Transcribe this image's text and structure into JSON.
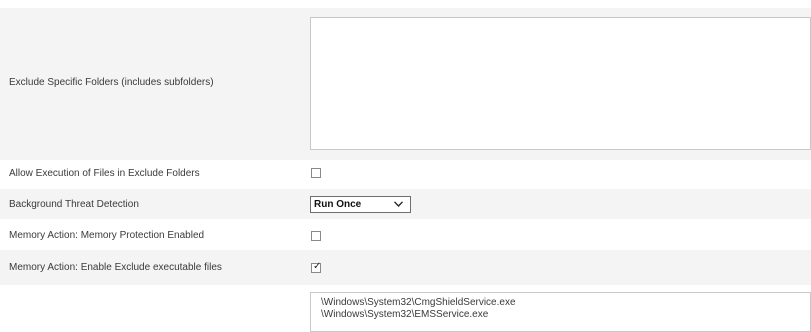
{
  "settings": {
    "exclude_folders": {
      "label": "Exclude Specific Folders (includes subfolders)",
      "value": ""
    },
    "allow_execution": {
      "label": "Allow Execution of Files in Exclude Folders",
      "checked": false
    },
    "background_detection": {
      "label": "Background Threat Detection",
      "selected": "Run Once"
    },
    "memory_protection": {
      "label": "Memory Action: Memory Protection Enabled",
      "checked": false
    },
    "exclude_executables": {
      "label": "Memory Action: Enable Exclude executable files",
      "checked": true
    },
    "excluded_executables": [
      "\\Windows\\System32\\CmgShieldService.exe",
      "\\Windows\\System32\\EMSService.exe"
    ]
  }
}
